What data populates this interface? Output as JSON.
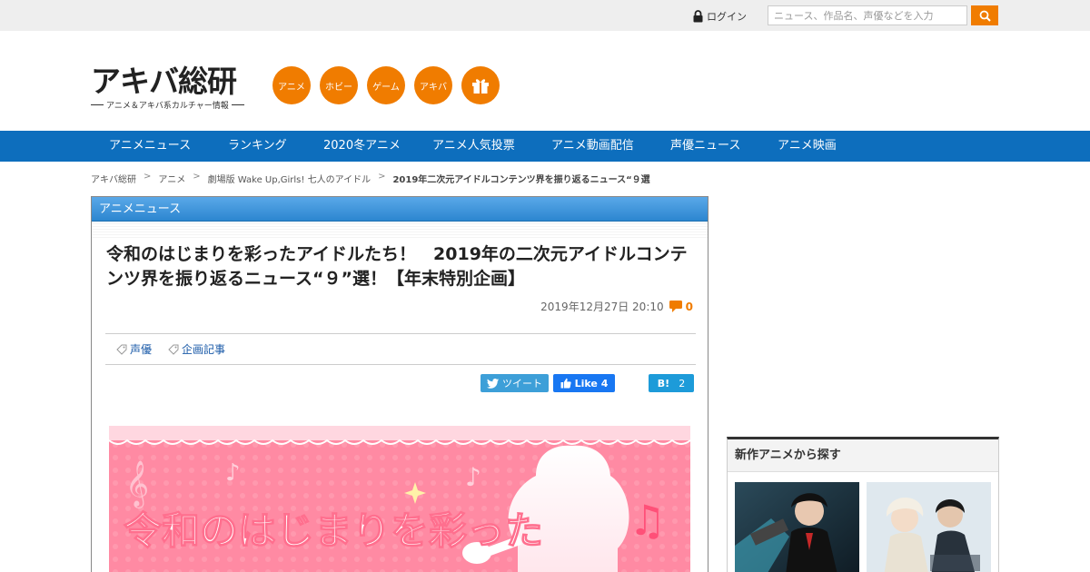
{
  "header": {
    "login_label": "ログイン",
    "search_placeholder": "ニュース、作品名、声優などを入力",
    "accent_color": "#f07c00"
  },
  "logo": {
    "main": "アキバ総研",
    "sub": "アニメ＆アキバ系カルチャー情報"
  },
  "categories": [
    {
      "label": "アニメ"
    },
    {
      "label": "ホビー"
    },
    {
      "label": "ゲーム"
    },
    {
      "label": "アキバ"
    },
    {
      "icon": "gift-icon"
    }
  ],
  "nav": {
    "color": "#0d6ebd",
    "items": [
      "アニメニュース",
      "ランキング",
      "2020冬アニメ",
      "アニメ人気投票",
      "アニメ動画配信",
      "声優ニュース",
      "アニメ映画"
    ]
  },
  "breadcrumb": [
    "アキバ総研",
    "アニメ",
    "劇場版 Wake Up,Girls! 七人のアイドル",
    "2019年二次元アイドルコンテンツ界を振り返るニュース“９選"
  ],
  "article": {
    "section": "アニメニュース",
    "title": "令和のはじまりを彩ったアイドルたち！　2019年の二次元アイドルコンテンツ界を振り返るニュース“９”選！【年末特別企画】",
    "date": "2019年12月27日 20:10",
    "comment_count": "0",
    "tags": [
      "声優",
      "企画記事"
    ],
    "share": {
      "tweet": "ツイート",
      "like": "Like 4",
      "hatena_label": "B!",
      "hatena_count": "2"
    },
    "hero_text": "令和のはじまりを彩った"
  },
  "sidebar": {
    "box_title": "新作アニメから探す"
  }
}
